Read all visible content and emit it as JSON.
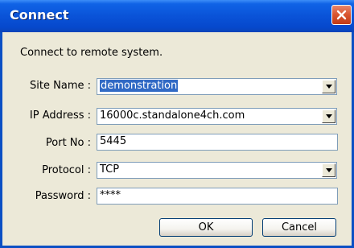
{
  "window": {
    "title": "Connect",
    "subtitle": "Connect to remote system."
  },
  "form": {
    "site_name": {
      "label": "Site Name :",
      "value": "demonstration"
    },
    "ip_address": {
      "label": "IP Address :",
      "value": "16000c.standalone4ch.com"
    },
    "port_no": {
      "label": "Port No :",
      "value": "5445"
    },
    "protocol": {
      "label": "Protocol :",
      "value": "TCP"
    },
    "password": {
      "label": "Password :",
      "value": "****"
    }
  },
  "buttons": {
    "ok": "OK",
    "cancel": "Cancel"
  },
  "colors": {
    "titlebar": "#0a53d8",
    "selection": "#316ac5",
    "close_button": "#d8542e"
  }
}
